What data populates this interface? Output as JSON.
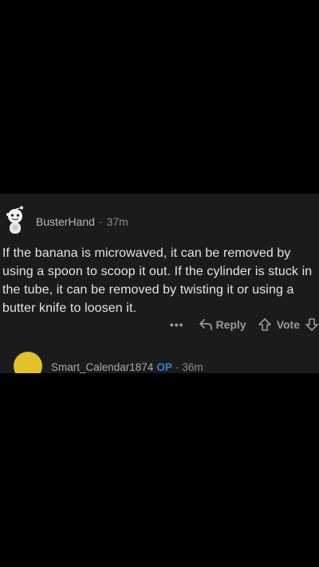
{
  "comment": {
    "username": "BusterHand",
    "separator": "·",
    "age": "37m",
    "body": "If the banana is microwaved, it can be removed by using a spoon to scoop it out. If the cylinder is stuck in the tube, it can be removed by twisting it or using a butter knife to loosen it.",
    "actions": {
      "more": "•••",
      "reply_label": "Reply",
      "vote_label": "Vote"
    }
  },
  "reply": {
    "username": "Smart_Calendar1874",
    "op_badge": "OP",
    "separator": "·",
    "age": "36m"
  },
  "icons": {
    "more": "ellipsis-icon",
    "reply": "reply-arrow-icon",
    "upvote": "upvote-arrow-icon",
    "downvote": "downvote-arrow-icon"
  },
  "colors": {
    "background": "#000000",
    "card": "#1b1b1d",
    "text": "#e4e4e6",
    "meta": "#8b8b8d",
    "op_badge": "#3d7bd8",
    "reply_avatar": "#e2c22a"
  }
}
